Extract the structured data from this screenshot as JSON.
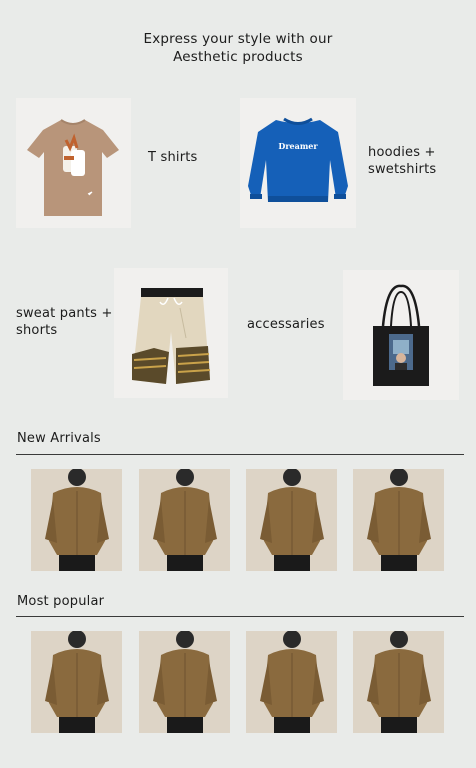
{
  "hero": {
    "line1": "Express your style with our",
    "line2": "Aesthetic products"
  },
  "categories": [
    {
      "label": "T shirts",
      "image_icon": "tshirt-image"
    },
    {
      "label_line1": "hoodies +",
      "label_line2": "swetshirts",
      "image_icon": "sweatshirt-image",
      "print_text": "Dreamer"
    },
    {
      "label_line1": "sweat pants +",
      "label_line2": "shorts",
      "image_icon": "shorts-image"
    },
    {
      "label": "accessaries",
      "image_icon": "tote-bag-image"
    }
  ],
  "sections": {
    "new_arrivals": {
      "title": "New Arrivals",
      "count": 4
    },
    "most_popular": {
      "title": "Most popular",
      "count": 4
    }
  },
  "colors": {
    "background": "#e9ebe9",
    "sweatshirt_blue": "#1560b8",
    "tshirt_tan": "#b8957a",
    "shirt_brown": "#8a6a3e"
  }
}
